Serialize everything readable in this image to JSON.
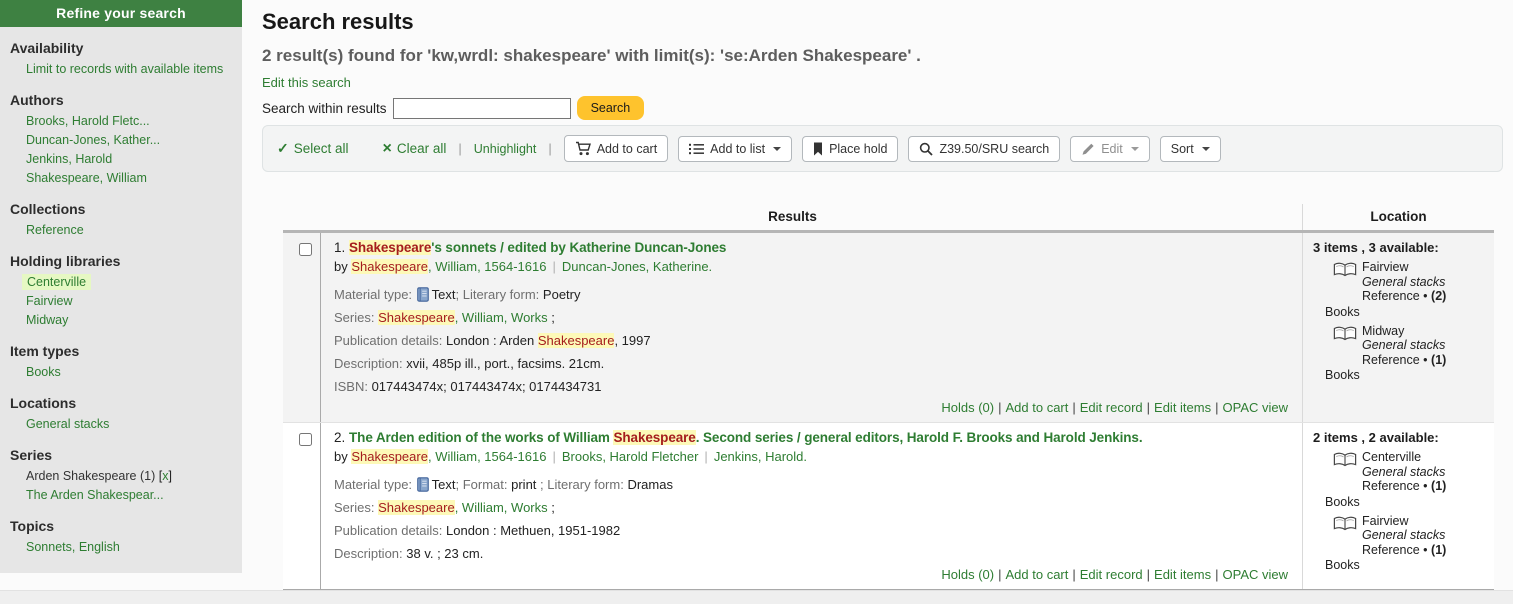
{
  "sep_pipe": "|",
  "bullet": "•",
  "refine": {
    "title": "Refine your search",
    "availability": {
      "heading": "Availability",
      "link": "Limit to records with available items"
    },
    "authors": {
      "heading": "Authors",
      "links": [
        "Brooks, Harold Fletc...",
        "Duncan-Jones, Kather...",
        "Jenkins, Harold",
        "Shakespeare, William"
      ]
    },
    "collections": {
      "heading": "Collections",
      "links": [
        "Reference"
      ]
    },
    "holding_libraries": {
      "heading": "Holding libraries",
      "active": "Centerville",
      "links": [
        "Fairview",
        "Midway"
      ]
    },
    "item_types": {
      "heading": "Item types",
      "links": [
        "Books"
      ]
    },
    "locations": {
      "heading": "Locations",
      "links": [
        "General stacks"
      ]
    },
    "series": {
      "heading": "Series",
      "applied_label": "Arden Shakespeare (1) ",
      "open": "[",
      "remove": "x",
      "close": "]",
      "links": [
        "The Arden Shakespear..."
      ]
    },
    "topics": {
      "heading": "Topics",
      "links": [
        "Sonnets, English"
      ]
    }
  },
  "header": {
    "page_title": "Search results",
    "result_summary": "2 result(s) found for 'kw,wrdl: shakespeare'  with limit(s): 'se:Arden Shakespeare' .",
    "edit_search": "Edit this search",
    "search_within_label": "Search within results",
    "search_button": "Search"
  },
  "toolbar": {
    "select_all": "Select all",
    "clear_all": "Clear all",
    "unhighlight": "Unhighlight",
    "add_to_cart": "Add to cart",
    "add_to_list": "Add to list",
    "place_hold": "Place hold",
    "z3950": "Z39.50/SRU search",
    "edit": "Edit",
    "sort": "Sort"
  },
  "results": {
    "header_results": "Results",
    "header_location": "Location",
    "rows": [
      {
        "number": "1.",
        "title": {
          "pre": "",
          "hl": "Shakespeare",
          "post": "'s sonnets / edited by Katherine Duncan-Jones"
        },
        "byline": {
          "by": "by ",
          "hl": "Shakespeare",
          "a1": ", William, 1564-1616",
          "a2": "Duncan-Jones, Katherine."
        },
        "material": {
          "label": "Material type: ",
          "v1": "Text",
          "g2": "; Literary form: ",
          "v2": "Poetry"
        },
        "series": {
          "label": "Series: ",
          "hl": "Shakespeare",
          "link": ", William, Works",
          "tail": " ;"
        },
        "publication": {
          "label": "Publication details: ",
          "v1": "London : Arden ",
          "hl": "Shakespeare",
          "v2": ", 1997"
        },
        "description": {
          "label": "Description: ",
          "value": "xvii, 485p ill., port., facsims. 21cm."
        },
        "isbn": {
          "label": "ISBN: ",
          "value": "017443474x; 017443474x; 0174434731"
        },
        "actions": {
          "holds": "Holds (0)",
          "cart": "Add to cart",
          "edit_record": "Edit record",
          "edit_items": "Edit items",
          "opac": "OPAC view"
        },
        "location": {
          "summary": "3 items , 3 available:",
          "entries": [
            {
              "library": "Fairview",
              "shelf": "General stacks",
              "collection": "Reference",
              "count": "(2)",
              "item_type": "Books"
            },
            {
              "library": "Midway",
              "shelf": "General stacks",
              "collection": "Reference",
              "count": "(1)",
              "item_type": "Books"
            }
          ]
        }
      },
      {
        "number": "2.",
        "title": {
          "pre": "The Arden edition of the works of William ",
          "hl": "Shakespeare",
          "post": ". Second series / general editors, Harold F. Brooks and Harold Jenkins."
        },
        "byline": {
          "by": "by ",
          "hl": "Shakespeare",
          "a1": ", William, 1564-1616",
          "a2": "Brooks, Harold Fletcher",
          "a3": "Jenkins, Harold."
        },
        "material": {
          "label": "Material type: ",
          "v1": "Text",
          "g2": "; Format: ",
          "v2": "print ",
          "g3": "; Literary form: ",
          "v3": "Dramas"
        },
        "series": {
          "label": "Series: ",
          "hl": "Shakespeare",
          "link": ", William, Works",
          "tail": " ;"
        },
        "publication": {
          "label": "Publication details: ",
          "v1": "London : Methuen, 1951-1982"
        },
        "description": {
          "label": "Description: ",
          "value": "38 v. ; 23 cm."
        },
        "actions": {
          "holds": "Holds (0)",
          "cart": "Add to cart",
          "edit_record": "Edit record",
          "edit_items": "Edit items",
          "opac": "OPAC view"
        },
        "location": {
          "summary": "2 items , 2 available:",
          "entries": [
            {
              "library": "Centerville",
              "shelf": "General stacks",
              "collection": "Reference",
              "count": "(1)",
              "item_type": "Books"
            },
            {
              "library": "Fairview",
              "shelf": "General stacks",
              "collection": "Reference",
              "count": "(1)",
              "item_type": "Books"
            }
          ]
        }
      }
    ]
  }
}
